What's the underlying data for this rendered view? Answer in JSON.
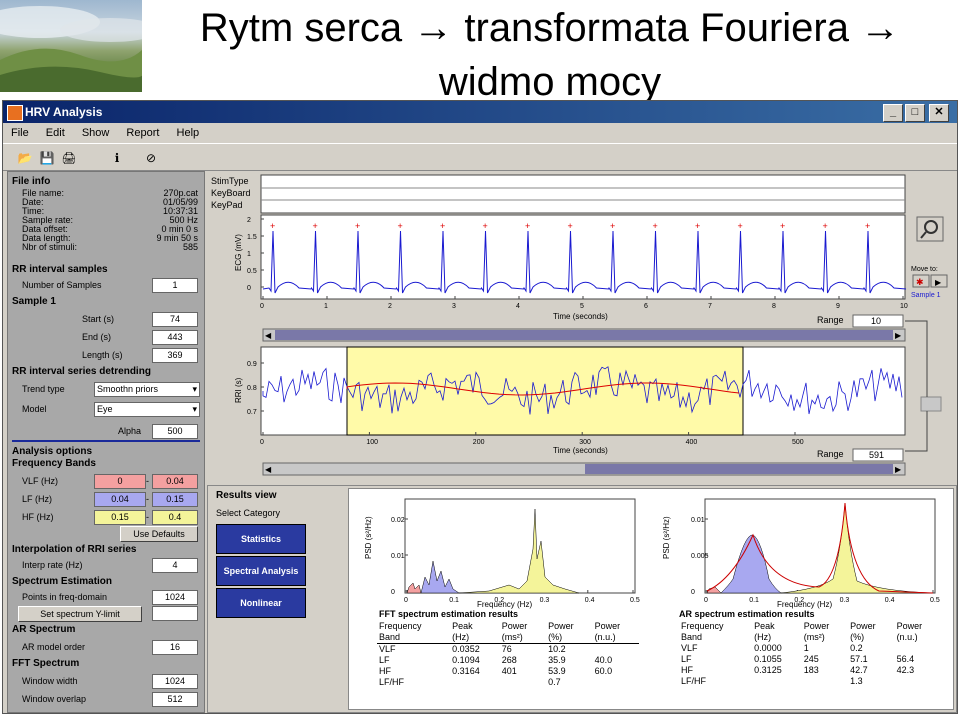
{
  "slide": {
    "title_line1": "Rytm serca → transformata Fouriera →",
    "title_line2": "widmo mocy"
  },
  "window": {
    "title": "HRV Analysis",
    "buttons": [
      "_",
      "□",
      "✕"
    ]
  },
  "menu": [
    "File",
    "Edit",
    "Show",
    "Report",
    "Help"
  ],
  "file_info": {
    "header": "File info",
    "rows": [
      {
        "label": "File name:",
        "value": "270p.cat"
      },
      {
        "label": "Date:",
        "value": "01/05/99"
      },
      {
        "label": "Time:",
        "value": "10:37:31"
      },
      {
        "label": "Sample rate:",
        "value": "500 Hz"
      },
      {
        "label": "Data offset:",
        "value": "0 min 0 s"
      },
      {
        "label": "Data length:",
        "value": "9 min 50 s"
      },
      {
        "label": "Nbr of stimuli:",
        "value": "585"
      }
    ]
  },
  "rr_samples": {
    "header": "RR interval samples",
    "num_label": "Number of Samples",
    "num_value": "1",
    "sample_header": "Sample 1",
    "start_label": "Start (s)",
    "start_value": "74",
    "end_label": "End (s)",
    "end_value": "443",
    "length_label": "Length (s)",
    "length_value": "369"
  },
  "detrending": {
    "header": "RR interval series detrending",
    "trend_label": "Trend type",
    "trend_value": "Smoothn priors",
    "model_label": "Model",
    "model_value": "Eye",
    "alpha_label": "Alpha",
    "alpha_value": "500"
  },
  "analysis": {
    "header": "Analysis options",
    "bands_header": "Frequency Bands",
    "vlf_label": "VLF (Hz)",
    "vlf_lo": "0",
    "vlf_hi": "0.04",
    "lf_label": "LF (Hz)",
    "lf_lo": "0.04",
    "lf_hi": "0.15",
    "hf_label": "HF (Hz)",
    "hf_lo": "0.15",
    "hf_hi": "0.4",
    "defaults_btn": "Use Defaults",
    "interp_header": "Interpolation of RRI series",
    "interp_label": "Interp rate (Hz)",
    "interp_value": "4",
    "spectrum_header": "Spectrum Estimation",
    "points_label": "Points in freq-domain",
    "points_value": "1024",
    "ylimit_btn": "Set spectrum Y-limit",
    "ar_header": "AR Spectrum",
    "ar_label": "AR model order",
    "ar_value": "16",
    "fft_header": "FFT Spectrum",
    "win_label": "Window width",
    "win_value": "1024",
    "overlap_label": "Window overlap",
    "overlap_value": "512"
  },
  "top_plot": {
    "rows": [
      "StimType",
      "KeyBoard",
      "KeyPad"
    ],
    "ylabel": "ECG (mV)",
    "xlabel": "Time (seconds)",
    "yticks": [
      "2",
      "1.5",
      "1",
      "0.5",
      "0"
    ],
    "xticks": [
      "0",
      "1",
      "2",
      "3",
      "4",
      "5",
      "6",
      "7",
      "8",
      "9",
      "10"
    ],
    "range_label": "Range",
    "range_value": "10",
    "moveto_label": "Move to:",
    "sample_label": "Sample 1"
  },
  "rri_plot": {
    "ylabel": "RRI (s)",
    "xlabel": "Time (seconds)",
    "yticks": [
      "0.9",
      "0.8",
      "0.7"
    ],
    "xticks": [
      "0",
      "100",
      "200",
      "300",
      "400",
      "500"
    ],
    "range_label": "Range",
    "range_value": "591"
  },
  "results": {
    "header": "Results view",
    "category_label": "Select Category",
    "buttons": [
      "Statistics",
      "Spectral Analysis",
      "Nonlinear"
    ]
  },
  "fft": {
    "ylabel": "PSD (s²/Hz)",
    "xlabel": "Frequency (Hz)",
    "yticks": [
      "0.02",
      "0.01",
      "0"
    ],
    "xticks": [
      "0",
      "0.1",
      "0.2",
      "0.3",
      "0.4",
      "0.5"
    ],
    "table_title": "FFT spectrum estimation results",
    "head1": [
      "Frequency",
      "Peak",
      "Power",
      "Power",
      "Power"
    ],
    "head2": [
      "Band",
      "(Hz)",
      "(ms²)",
      "(%)",
      "(n.u.)"
    ],
    "rows": [
      [
        "VLF",
        "0.0352",
        "76",
        "10.2",
        ""
      ],
      [
        "LF",
        "0.1094",
        "268",
        "35.9",
        "40.0"
      ],
      [
        "HF",
        "0.3164",
        "401",
        "53.9",
        "60.0"
      ],
      [
        "LF/HF",
        "",
        "",
        "0.7",
        ""
      ]
    ]
  },
  "ar": {
    "ylabel": "PSD (s²/Hz)",
    "xlabel": "Frequency (Hz)",
    "yticks": [
      "0.01",
      "0.005",
      "0"
    ],
    "xticks": [
      "0",
      "0.1",
      "0.2",
      "0.3",
      "0.4",
      "0.5"
    ],
    "table_title": "AR spectrum estimation results",
    "head1": [
      "Frequency",
      "Peak",
      "Power",
      "Power",
      "Power"
    ],
    "head2": [
      "Band",
      "(Hz)",
      "(ms²)",
      "(%)",
      "(n.u.)"
    ],
    "rows": [
      [
        "VLF",
        "0.0000",
        "1",
        "0.2",
        ""
      ],
      [
        "LF",
        "0.1055",
        "245",
        "57.1",
        "56.4"
      ],
      [
        "HF",
        "0.3125",
        "183",
        "42.7",
        "42.3"
      ],
      [
        "LF/HF",
        "",
        "",
        "1.3",
        ""
      ]
    ]
  },
  "colors": {
    "vlf": "#f4a0a0",
    "lf": "#a8a8f0",
    "hf": "#f4f49a",
    "series": "#1a1ad0",
    "highlight": "#fffaa8"
  }
}
